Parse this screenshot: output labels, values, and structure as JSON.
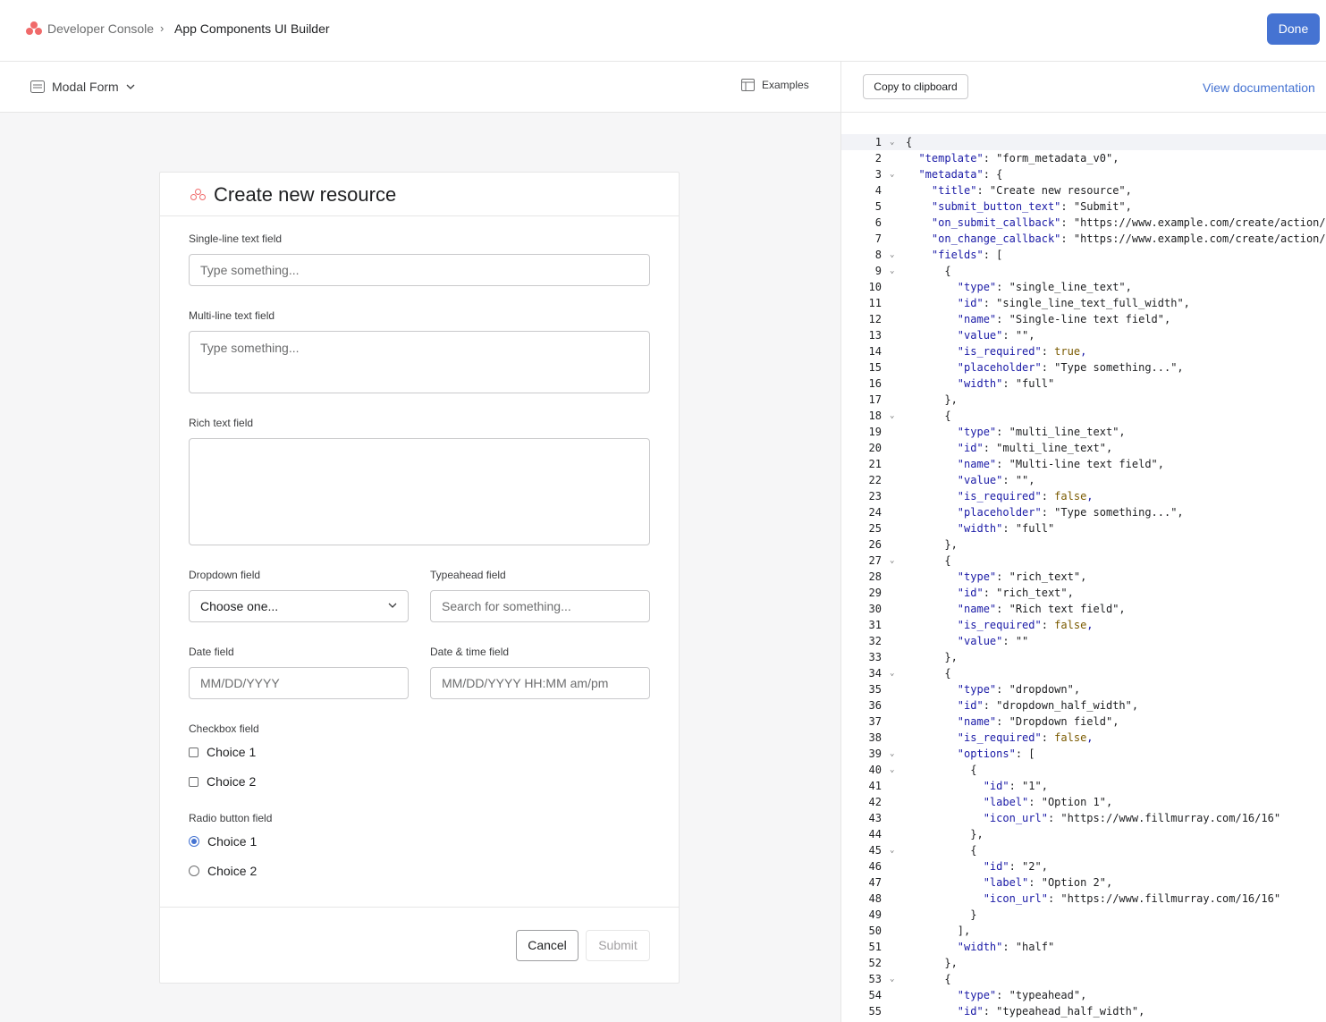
{
  "topbar": {
    "breadcrumb_root": "Developer Console",
    "breadcrumb_sep": "›",
    "breadcrumb_current": "App Components UI Builder",
    "done_label": "Done"
  },
  "toolbar": {
    "template_select": "Modal Form",
    "examples_label": "Examples"
  },
  "code_toolbar": {
    "copy_label": "Copy to clipboard",
    "doc_label": "View documentation"
  },
  "form": {
    "title": "Create new resource",
    "single_label": "Single-line text field",
    "single_placeholder": "Type something...",
    "multi_label": "Multi-line text field",
    "multi_placeholder": "Type something...",
    "rich_label": "Rich text field",
    "dropdown_label": "Dropdown field",
    "dropdown_value": "Choose one...",
    "typeahead_label": "Typeahead field",
    "typeahead_placeholder": "Search for something...",
    "date_label": "Date field",
    "date_placeholder": "MM/DD/YYYY",
    "datetime_label": "Date & time field",
    "datetime_placeholder": "MM/DD/YYYY HH:MM am/pm",
    "checkbox_label": "Checkbox field",
    "checkbox_choices": [
      {
        "label": "Choice 1",
        "checked": false
      },
      {
        "label": "Choice 2",
        "checked": false
      }
    ],
    "radio_label": "Radio button field",
    "radio_choices": [
      {
        "label": "Choice 1",
        "selected": true
      },
      {
        "label": "Choice 2",
        "selected": false
      }
    ],
    "cancel_label": "Cancel",
    "submit_label": "Submit"
  },
  "code_lines": [
    {
      "n": "1",
      "fold": true,
      "text": "{"
    },
    {
      "n": "2",
      "fold": false,
      "text": "  \"template\": \"form_metadata_v0\","
    },
    {
      "n": "3",
      "fold": true,
      "text": "  \"metadata\": {"
    },
    {
      "n": "4",
      "fold": false,
      "text": "    \"title\": \"Create new resource\","
    },
    {
      "n": "5",
      "fold": false,
      "text": "    \"submit_button_text\": \"Submit\","
    },
    {
      "n": "6",
      "fold": false,
      "text": "    \"on_submit_callback\": \"https://www.example.com/create/action/"
    },
    {
      "n": "7",
      "fold": false,
      "text": "    \"on_change_callback\": \"https://www.example.com/create/action/"
    },
    {
      "n": "8",
      "fold": true,
      "text": "    \"fields\": ["
    },
    {
      "n": "9",
      "fold": true,
      "text": "      {"
    },
    {
      "n": "10",
      "fold": false,
      "text": "        \"type\": \"single_line_text\","
    },
    {
      "n": "11",
      "fold": false,
      "text": "        \"id\": \"single_line_text_full_width\","
    },
    {
      "n": "12",
      "fold": false,
      "text": "        \"name\": \"Single-line text field\","
    },
    {
      "n": "13",
      "fold": false,
      "text": "        \"value\": \"\","
    },
    {
      "n": "14",
      "fold": false,
      "text": "        \"is_required\": true,"
    },
    {
      "n": "15",
      "fold": false,
      "text": "        \"placeholder\": \"Type something...\","
    },
    {
      "n": "16",
      "fold": false,
      "text": "        \"width\": \"full\""
    },
    {
      "n": "17",
      "fold": false,
      "text": "      },"
    },
    {
      "n": "18",
      "fold": true,
      "text": "      {"
    },
    {
      "n": "19",
      "fold": false,
      "text": "        \"type\": \"multi_line_text\","
    },
    {
      "n": "20",
      "fold": false,
      "text": "        \"id\": \"multi_line_text\","
    },
    {
      "n": "21",
      "fold": false,
      "text": "        \"name\": \"Multi-line text field\","
    },
    {
      "n": "22",
      "fold": false,
      "text": "        \"value\": \"\","
    },
    {
      "n": "23",
      "fold": false,
      "text": "        \"is_required\": false,"
    },
    {
      "n": "24",
      "fold": false,
      "text": "        \"placeholder\": \"Type something...\","
    },
    {
      "n": "25",
      "fold": false,
      "text": "        \"width\": \"full\""
    },
    {
      "n": "26",
      "fold": false,
      "text": "      },"
    },
    {
      "n": "27",
      "fold": true,
      "text": "      {"
    },
    {
      "n": "28",
      "fold": false,
      "text": "        \"type\": \"rich_text\","
    },
    {
      "n": "29",
      "fold": false,
      "text": "        \"id\": \"rich_text\","
    },
    {
      "n": "30",
      "fold": false,
      "text": "        \"name\": \"Rich text field\","
    },
    {
      "n": "31",
      "fold": false,
      "text": "        \"is_required\": false,"
    },
    {
      "n": "32",
      "fold": false,
      "text": "        \"value\": \"\""
    },
    {
      "n": "33",
      "fold": false,
      "text": "      },"
    },
    {
      "n": "34",
      "fold": true,
      "text": "      {"
    },
    {
      "n": "35",
      "fold": false,
      "text": "        \"type\": \"dropdown\","
    },
    {
      "n": "36",
      "fold": false,
      "text": "        \"id\": \"dropdown_half_width\","
    },
    {
      "n": "37",
      "fold": false,
      "text": "        \"name\": \"Dropdown field\","
    },
    {
      "n": "38",
      "fold": false,
      "text": "        \"is_required\": false,"
    },
    {
      "n": "39",
      "fold": true,
      "text": "        \"options\": ["
    },
    {
      "n": "40",
      "fold": true,
      "text": "          {"
    },
    {
      "n": "41",
      "fold": false,
      "text": "            \"id\": \"1\","
    },
    {
      "n": "42",
      "fold": false,
      "text": "            \"label\": \"Option 1\","
    },
    {
      "n": "43",
      "fold": false,
      "text": "            \"icon_url\": \"https://www.fillmurray.com/16/16\""
    },
    {
      "n": "44",
      "fold": false,
      "text": "          },"
    },
    {
      "n": "45",
      "fold": true,
      "text": "          {"
    },
    {
      "n": "46",
      "fold": false,
      "text": "            \"id\": \"2\","
    },
    {
      "n": "47",
      "fold": false,
      "text": "            \"label\": \"Option 2\","
    },
    {
      "n": "48",
      "fold": false,
      "text": "            \"icon_url\": \"https://www.fillmurray.com/16/16\""
    },
    {
      "n": "49",
      "fold": false,
      "text": "          }"
    },
    {
      "n": "50",
      "fold": false,
      "text": "        ],"
    },
    {
      "n": "51",
      "fold": false,
      "text": "        \"width\": \"half\""
    },
    {
      "n": "52",
      "fold": false,
      "text": "      },"
    },
    {
      "n": "53",
      "fold": true,
      "text": "      {"
    },
    {
      "n": "54",
      "fold": false,
      "text": "        \"type\": \"typeahead\","
    },
    {
      "n": "55",
      "fold": false,
      "text": "        \"id\": \"typeahead_half_width\","
    }
  ],
  "colors": {
    "accent": "#4573d2",
    "brand": "#f06a6a",
    "json_key": "#1a1aa6",
    "json_bool": "#7a5a00"
  }
}
